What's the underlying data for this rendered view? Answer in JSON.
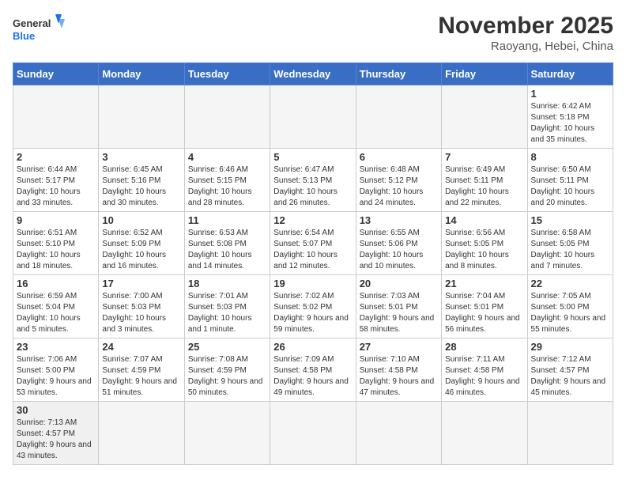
{
  "header": {
    "logo_general": "General",
    "logo_blue": "Blue",
    "month_title": "November 2025",
    "location": "Raoyang, Hebei, China"
  },
  "weekdays": [
    "Sunday",
    "Monday",
    "Tuesday",
    "Wednesday",
    "Thursday",
    "Friday",
    "Saturday"
  ],
  "weeks": [
    [
      {
        "day": "",
        "content": ""
      },
      {
        "day": "",
        "content": ""
      },
      {
        "day": "",
        "content": ""
      },
      {
        "day": "",
        "content": ""
      },
      {
        "day": "",
        "content": ""
      },
      {
        "day": "",
        "content": ""
      },
      {
        "day": "1",
        "content": "Sunrise: 6:42 AM\nSunset: 5:18 PM\nDaylight: 10 hours\nand 35 minutes."
      }
    ],
    [
      {
        "day": "2",
        "content": "Sunrise: 6:44 AM\nSunset: 5:17 PM\nDaylight: 10 hours\nand 33 minutes."
      },
      {
        "day": "3",
        "content": "Sunrise: 6:45 AM\nSunset: 5:16 PM\nDaylight: 10 hours\nand 30 minutes."
      },
      {
        "day": "4",
        "content": "Sunrise: 6:46 AM\nSunset: 5:15 PM\nDaylight: 10 hours\nand 28 minutes."
      },
      {
        "day": "5",
        "content": "Sunrise: 6:47 AM\nSunset: 5:13 PM\nDaylight: 10 hours\nand 26 minutes."
      },
      {
        "day": "6",
        "content": "Sunrise: 6:48 AM\nSunset: 5:12 PM\nDaylight: 10 hours\nand 24 minutes."
      },
      {
        "day": "7",
        "content": "Sunrise: 6:49 AM\nSunset: 5:11 PM\nDaylight: 10 hours\nand 22 minutes."
      },
      {
        "day": "8",
        "content": "Sunrise: 6:50 AM\nSunset: 5:11 PM\nDaylight: 10 hours\nand 20 minutes."
      }
    ],
    [
      {
        "day": "9",
        "content": "Sunrise: 6:51 AM\nSunset: 5:10 PM\nDaylight: 10 hours\nand 18 minutes."
      },
      {
        "day": "10",
        "content": "Sunrise: 6:52 AM\nSunset: 5:09 PM\nDaylight: 10 hours\nand 16 minutes."
      },
      {
        "day": "11",
        "content": "Sunrise: 6:53 AM\nSunset: 5:08 PM\nDaylight: 10 hours\nand 14 minutes."
      },
      {
        "day": "12",
        "content": "Sunrise: 6:54 AM\nSunset: 5:07 PM\nDaylight: 10 hours\nand 12 minutes."
      },
      {
        "day": "13",
        "content": "Sunrise: 6:55 AM\nSunset: 5:06 PM\nDaylight: 10 hours\nand 10 minutes."
      },
      {
        "day": "14",
        "content": "Sunrise: 6:56 AM\nSunset: 5:05 PM\nDaylight: 10 hours\nand 8 minutes."
      },
      {
        "day": "15",
        "content": "Sunrise: 6:58 AM\nSunset: 5:05 PM\nDaylight: 10 hours\nand 7 minutes."
      }
    ],
    [
      {
        "day": "16",
        "content": "Sunrise: 6:59 AM\nSunset: 5:04 PM\nDaylight: 10 hours\nand 5 minutes."
      },
      {
        "day": "17",
        "content": "Sunrise: 7:00 AM\nSunset: 5:03 PM\nDaylight: 10 hours\nand 3 minutes."
      },
      {
        "day": "18",
        "content": "Sunrise: 7:01 AM\nSunset: 5:03 PM\nDaylight: 10 hours\nand 1 minute."
      },
      {
        "day": "19",
        "content": "Sunrise: 7:02 AM\nSunset: 5:02 PM\nDaylight: 9 hours\nand 59 minutes."
      },
      {
        "day": "20",
        "content": "Sunrise: 7:03 AM\nSunset: 5:01 PM\nDaylight: 9 hours\nand 58 minutes."
      },
      {
        "day": "21",
        "content": "Sunrise: 7:04 AM\nSunset: 5:01 PM\nDaylight: 9 hours\nand 56 minutes."
      },
      {
        "day": "22",
        "content": "Sunrise: 7:05 AM\nSunset: 5:00 PM\nDaylight: 9 hours\nand 55 minutes."
      }
    ],
    [
      {
        "day": "23",
        "content": "Sunrise: 7:06 AM\nSunset: 5:00 PM\nDaylight: 9 hours\nand 53 minutes."
      },
      {
        "day": "24",
        "content": "Sunrise: 7:07 AM\nSunset: 4:59 PM\nDaylight: 9 hours\nand 51 minutes."
      },
      {
        "day": "25",
        "content": "Sunrise: 7:08 AM\nSunset: 4:59 PM\nDaylight: 9 hours\nand 50 minutes."
      },
      {
        "day": "26",
        "content": "Sunrise: 7:09 AM\nSunset: 4:58 PM\nDaylight: 9 hours\nand 49 minutes."
      },
      {
        "day": "27",
        "content": "Sunrise: 7:10 AM\nSunset: 4:58 PM\nDaylight: 9 hours\nand 47 minutes."
      },
      {
        "day": "28",
        "content": "Sunrise: 7:11 AM\nSunset: 4:58 PM\nDaylight: 9 hours\nand 46 minutes."
      },
      {
        "day": "29",
        "content": "Sunrise: 7:12 AM\nSunset: 4:57 PM\nDaylight: 9 hours\nand 45 minutes."
      }
    ],
    [
      {
        "day": "30",
        "content": "Sunrise: 7:13 AM\nSunset: 4:57 PM\nDaylight: 9 hours\nand 43 minutes."
      },
      {
        "day": "",
        "content": ""
      },
      {
        "day": "",
        "content": ""
      },
      {
        "day": "",
        "content": ""
      },
      {
        "day": "",
        "content": ""
      },
      {
        "day": "",
        "content": ""
      },
      {
        "day": "",
        "content": ""
      }
    ]
  ]
}
